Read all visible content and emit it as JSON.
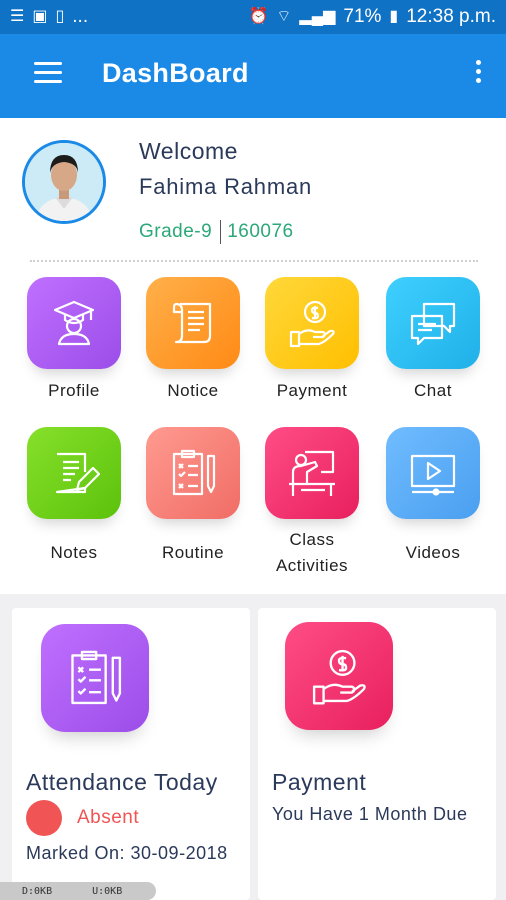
{
  "status_bar": {
    "battery": "71%",
    "time": "12:38 p.m.",
    "left_icons": [
      "list-icon",
      "photo-icon",
      "phone-icon"
    ],
    "ellipsis": "...",
    "right_icons": [
      "alarm-icon",
      "wifi-icon",
      "signal-icon",
      "battery-icon"
    ]
  },
  "app_bar": {
    "title": "DashBoard",
    "background": "#1a8ae6"
  },
  "profile": {
    "welcome": "Welcome",
    "name": "Fahima Rahman",
    "grade": "Grade-9",
    "id": "160076"
  },
  "menu": [
    {
      "label": "Profile",
      "icon": "graduate-icon",
      "color": "#b25cf0"
    },
    {
      "label": "Notice",
      "icon": "scroll-icon",
      "color": "#ff9a2e"
    },
    {
      "label": "Payment",
      "icon": "money-hand-icon",
      "color": "#ffcc18"
    },
    {
      "label": "Chat",
      "icon": "chat-bubbles-icon",
      "color": "#2ec0f0"
    },
    {
      "label": "Notes",
      "icon": "note-edit-icon",
      "color": "#6fd417"
    },
    {
      "label": "Routine",
      "icon": "clipboard-list-icon",
      "color": "#f47f78"
    },
    {
      "label": "Class Activities",
      "icon": "classroom-icon",
      "color": "#f4356f"
    },
    {
      "label": "Videos",
      "icon": "video-play-icon",
      "color": "#5aaef5"
    }
  ],
  "attendance": {
    "title": "Attendance Today",
    "status": "Absent",
    "marked_on": "Marked On: 30-09-2018",
    "status_color": "#f05454"
  },
  "payment_card": {
    "title": "Payment",
    "due": "You Have 1 Month Due"
  },
  "net_speed": {
    "down": "D:0KB",
    "up": "U:0KB"
  }
}
